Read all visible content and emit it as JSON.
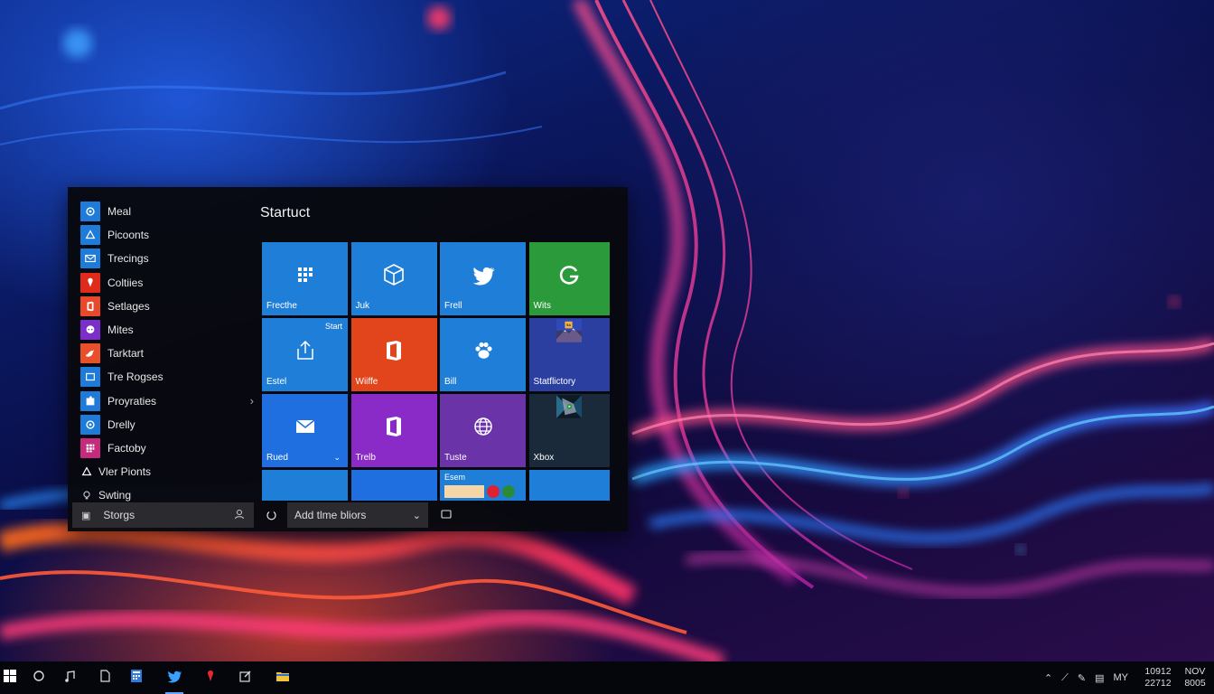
{
  "start_menu": {
    "apps": [
      {
        "label": "Meal",
        "icon": "gear-icon",
        "color": "#1e7bd9"
      },
      {
        "label": "Picoonts",
        "icon": "settings-icon",
        "color": "#1e7bd9"
      },
      {
        "label": "Trecings",
        "icon": "mail-icon",
        "color": "#1e7bd9"
      },
      {
        "label": "Coltiies",
        "icon": "pin-icon",
        "color": "#e02b1c"
      },
      {
        "label": "Setlages",
        "icon": "office-icon",
        "color": "#e8492b"
      },
      {
        "label": "Mites",
        "icon": "chat-icon",
        "color": "#7b2fc8"
      },
      {
        "label": "Tarktart",
        "icon": "bird-icon",
        "color": "#e8502b"
      },
      {
        "label": "Tre Rogses",
        "icon": "window-icon",
        "color": "#1e7bd9"
      },
      {
        "label": "Proyraties",
        "icon": "puzzle-icon",
        "color": "#1e7bd9"
      },
      {
        "label": "Drelly",
        "icon": "gear-icon",
        "color": "#1e7bd9"
      },
      {
        "label": "Factoby",
        "icon": "grid-icon",
        "color": "#c42b7c"
      },
      {
        "label": "Vler Pionts",
        "icon": "settings-icon",
        "color": ""
      },
      {
        "label": "Swting",
        "icon": "lightbulb-icon",
        "color": ""
      }
    ],
    "heading": "Startuct",
    "tiles": [
      {
        "label": "Frecthe",
        "icon": "grid-icon",
        "color": "#1f7fd8",
        "badge": "",
        "chev": ""
      },
      {
        "label": "Juk",
        "icon": "cube-icon",
        "color": "#1f7fd8",
        "badge": "",
        "chev": ""
      },
      {
        "label": "Frell",
        "icon": "twitter-icon",
        "color": "#1f7fd8",
        "badge": "",
        "chev": ""
      },
      {
        "label": "Wits",
        "icon": "g-icon",
        "color": "#2a9a3a",
        "badge": "",
        "chev": ""
      },
      {
        "label": "Estel",
        "icon": "share-icon",
        "color": "#1f7fd8",
        "badge": "Start",
        "chev": ""
      },
      {
        "label": "Wiiffe",
        "icon": "office-icon",
        "color": "#e2451b",
        "badge": "",
        "chev": ""
      },
      {
        "label": "Bill",
        "icon": "paw-icon",
        "color": "#1f7fd8",
        "badge": "",
        "chev": ""
      },
      {
        "label": "Statflictory",
        "icon": "mountain-photo-icon",
        "color": "#2b3fa0",
        "badge": "",
        "chev": ""
      },
      {
        "label": "Rued",
        "icon": "mail-icon",
        "color": "#1f6fe0",
        "badge": "",
        "chev": "⌄"
      },
      {
        "label": "Trelb",
        "icon": "office-icon",
        "color": "#8a2bc8",
        "badge": "",
        "chev": ""
      },
      {
        "label": "Tuste",
        "icon": "globe-icon",
        "color": "#6a34a8",
        "badge": "",
        "chev": ""
      },
      {
        "label": "Xbox",
        "icon": "xbox-photo-icon",
        "color": "#1a2a3a",
        "badge": "",
        "chev": ""
      }
    ],
    "partial_tile_label": "Esem",
    "bottom": {
      "account_label": "Storgs",
      "dropdown_label": "Add tlme bliors"
    }
  },
  "taskbar": {
    "items": [
      {
        "icon": "windows-icon",
        "active": false
      },
      {
        "icon": "search-icon",
        "active": false
      },
      {
        "icon": "music-icon",
        "active": false
      },
      {
        "icon": "file-icon",
        "active": false
      },
      {
        "icon": "calculator-icon",
        "active": false
      },
      {
        "icon": "twitter-icon",
        "active": true
      },
      {
        "icon": "pin-icon",
        "active": false
      },
      {
        "icon": "edit-icon",
        "active": false
      },
      {
        "icon": "folder-icon",
        "active": false
      }
    ],
    "tray": {
      "lang": "MY",
      "time_line1": "10912",
      "time_line2": "22712",
      "date_line1": "NOV",
      "date_line2": "8005"
    }
  }
}
